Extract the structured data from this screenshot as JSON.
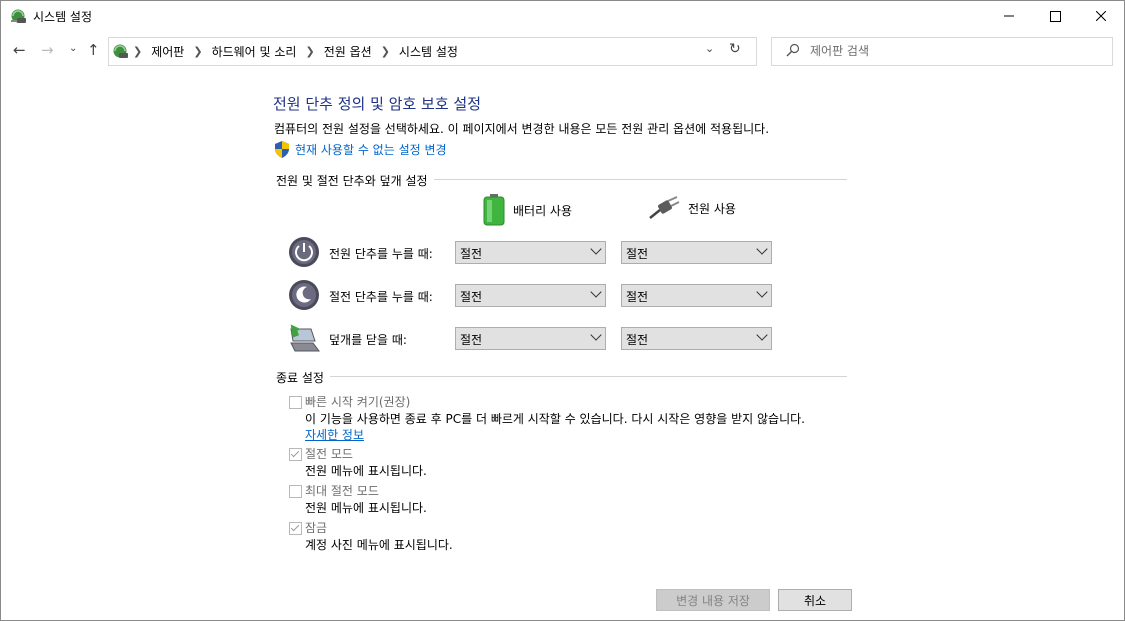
{
  "window": {
    "title": "시스템 설정"
  },
  "nav": {
    "breadcrumbs": [
      "제어판",
      "하드웨어 및 소리",
      "전원 옵션",
      "시스템 설정"
    ],
    "search_placeholder": "제어판 검색"
  },
  "main": {
    "heading": "전원 단추 정의 및 암호 보호 설정",
    "description": "컴퓨터의 전원 설정을 선택하세요. 이 페이지에서 변경한 내용은 모든 전원 관리 옵션에 적용됩니다.",
    "change_link": "현재 사용할 수 없는 설정 변경",
    "power_section": {
      "title": "전원 및 절전 단추와 덮개 설정",
      "col_battery": "배터리 사용",
      "col_plugged": "전원 사용",
      "rows": [
        {
          "label": "전원 단추를 누를 때:",
          "battery": "절전",
          "plugged": "절전"
        },
        {
          "label": "절전 단추를 누를 때:",
          "battery": "절전",
          "plugged": "절전"
        },
        {
          "label": "덮개를 닫을 때:",
          "battery": "절전",
          "plugged": "절전"
        }
      ]
    },
    "shutdown_section": {
      "title": "종료 설정",
      "items": [
        {
          "label": "빠른 시작 켜기(권장)",
          "desc": "이 기능을 사용하면 종료 후 PC를 더 빠르게 시작할 수 있습니다. 다시 시작은 영향을 받지 않습니다.",
          "checked": false
        },
        {
          "label": "절전 모드",
          "desc": "전원 메뉴에 표시됩니다.",
          "checked": true
        },
        {
          "label": "최대 절전 모드",
          "desc": "전원 메뉴에 표시됩니다.",
          "checked": false
        },
        {
          "label": "잠금",
          "desc": "계정 사진 메뉴에 표시됩니다.",
          "checked": true
        }
      ],
      "more_link": "자세한 정보"
    }
  },
  "footer": {
    "save_label": "변경 내용 저장",
    "cancel_label": "취소"
  },
  "colors": {
    "heading": "#1e3287",
    "link": "#0066cc",
    "disabled_text": "#6d6d6d"
  }
}
